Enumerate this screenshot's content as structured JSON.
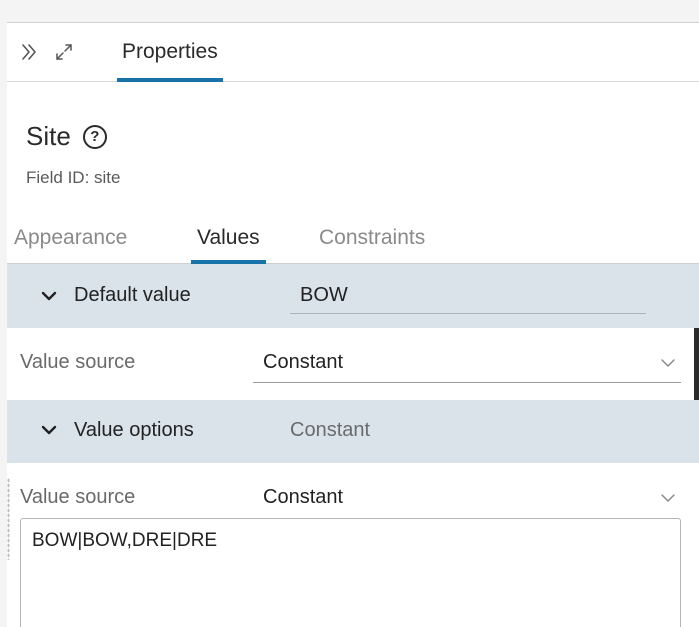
{
  "header": {
    "collapse_icon": "double-chevron-right-icon",
    "expand_icon": "expand-arrows-icon",
    "tab_label": "Properties"
  },
  "field": {
    "title": "Site",
    "help_icon": "question-circle-icon",
    "help_glyph": "?",
    "field_id_text": "Field ID: site"
  },
  "tabs": [
    {
      "label": "Appearance",
      "active": false
    },
    {
      "label": "Values",
      "active": true
    },
    {
      "label": "Constraints",
      "active": false
    }
  ],
  "default_value": {
    "label": "Default value",
    "value": "BOW",
    "value_source_label": "Value source",
    "value_source": "Constant"
  },
  "value_options": {
    "label": "Value options",
    "summary": "Constant",
    "value_source_label": "Value source",
    "value_source": "Constant",
    "options_text": "BOW|BOW,DRE|DRE"
  },
  "colors": {
    "accent": "#1773a8",
    "section_bg": "#dae3ea"
  }
}
